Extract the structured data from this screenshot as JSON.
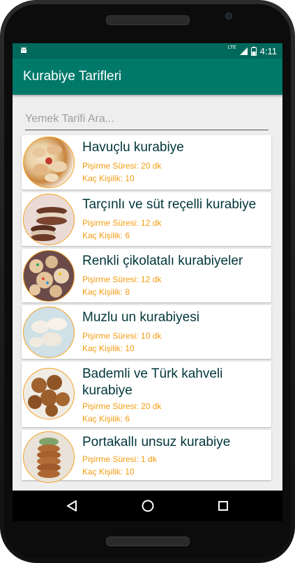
{
  "status_bar": {
    "time": "4:11",
    "network": "LTE",
    "icons": [
      "android-notification-icon",
      "signal-icon",
      "battery-icon"
    ]
  },
  "app_bar": {
    "title": "Kurabiye Tarifleri",
    "color": "#00796b",
    "status_color": "#00695c"
  },
  "search": {
    "placeholder": "Yemek Tarifi Ara..."
  },
  "recipes": [
    {
      "title": "Havuçlu kurabiye",
      "cook_time": "Pişirme Süresi: 20 dk",
      "servings": "Kaç Kişilik: 10"
    },
    {
      "title": "Tarçınlı ve süt reçelli kurabiye",
      "cook_time": "Pişirme Süresi: 12 dk",
      "servings": "Kaç Kişilik: 6"
    },
    {
      "title": "Renkli çikolatalı kurabiyeler",
      "cook_time": "Pişirme Süresi: 12 dk",
      "servings": "Kaç Kişilik: 8"
    },
    {
      "title": "Muzlu un kurabiyesi",
      "cook_time": "Pişirme Süresi: 10 dk",
      "servings": "Kaç Kişilik: 10"
    },
    {
      "title": "Bademli ve Türk kahveli kurabiye",
      "cook_time": "Pişirme Süresi: 20 dk",
      "servings": "Kaç Kişilik: 6"
    },
    {
      "title": "Portakallı unsuz kurabiye",
      "cook_time": "Pişirme Süresi: 1 dk",
      "servings": "Kaç Kişilik: 10"
    }
  ],
  "accent_color": "#f39c12",
  "nav": [
    "back-icon",
    "home-icon",
    "recents-icon"
  ]
}
